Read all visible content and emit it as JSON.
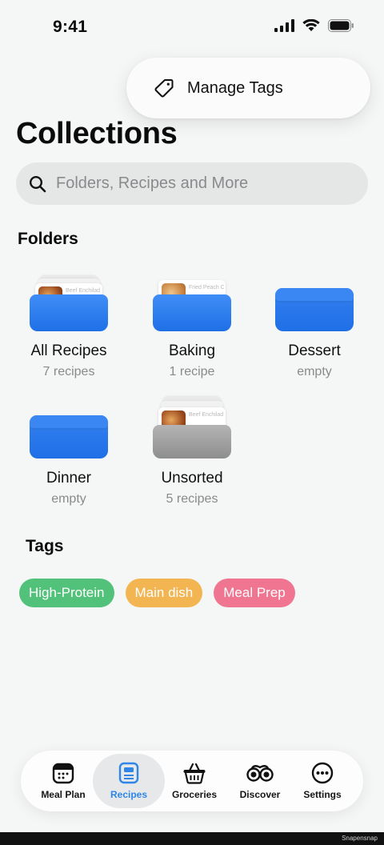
{
  "status": {
    "time": "9:41"
  },
  "popover": {
    "label": "Manage Tags",
    "icon": "tag-icon"
  },
  "page": {
    "title": "Collections"
  },
  "search": {
    "placeholder": "Folders, Recipes and More"
  },
  "folders_section": {
    "title": "Folders"
  },
  "folders": [
    {
      "name": "All Recipes",
      "count": "7 recipes",
      "card_text": "Beef Enchilad…"
    },
    {
      "name": "Baking",
      "count": "1 recipe",
      "card_text": "Fried Peach Co…"
    },
    {
      "name": "Dessert",
      "count": "empty"
    },
    {
      "name": "Dinner",
      "count": "empty"
    },
    {
      "name": "Unsorted",
      "count": "5 recipes",
      "card_text": "Beef Enchilad…"
    }
  ],
  "tags_section": {
    "title": "Tags"
  },
  "tags": [
    {
      "label": "High-Protein",
      "color": "#52c27a"
    },
    {
      "label": "Main dish",
      "color": "#f3b552"
    },
    {
      "label": "Meal Prep",
      "color": "#ef7590"
    }
  ],
  "tabbar": {
    "active": "Recipes",
    "tabs": [
      {
        "label": "Meal Plan",
        "icon": "calendar-icon"
      },
      {
        "label": "Recipes",
        "icon": "recipe-card-icon"
      },
      {
        "label": "Groceries",
        "icon": "basket-icon"
      },
      {
        "label": "Discover",
        "icon": "binoculars-icon"
      },
      {
        "label": "Settings",
        "icon": "ellipsis-circle-icon"
      }
    ]
  },
  "colors": {
    "accent": "#2f86e8",
    "folder_blue": "#2a79ec",
    "folder_gray": "#9d9d9d"
  },
  "watermark": "Snapensnap"
}
